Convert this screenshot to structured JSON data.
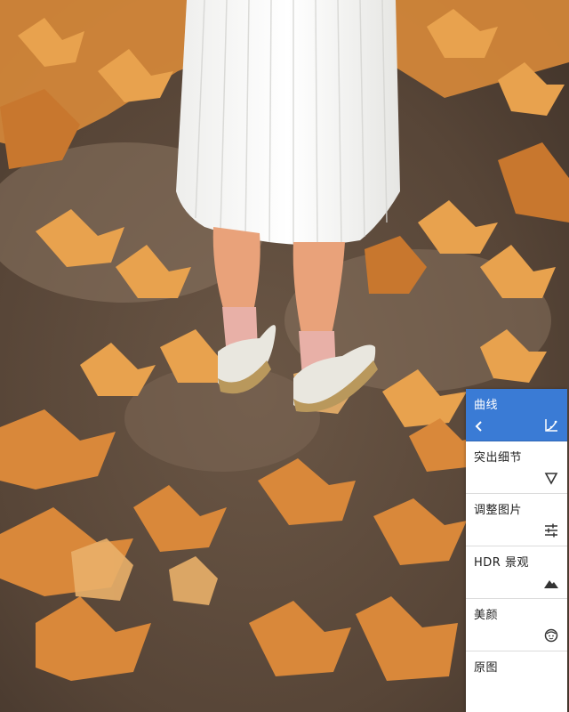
{
  "panel": {
    "items": [
      {
        "label": "曲线",
        "icon": "curve-icon",
        "active": true
      },
      {
        "label": "突出细节",
        "icon": "triangle-down-icon"
      },
      {
        "label": "调整图片",
        "icon": "sliders-icon"
      },
      {
        "label": "HDR 景观",
        "icon": "mountain-icon"
      },
      {
        "label": "美颜",
        "icon": "face-icon"
      },
      {
        "label": "原图",
        "icon": ""
      }
    ],
    "active_color": "#3a7bd5"
  }
}
